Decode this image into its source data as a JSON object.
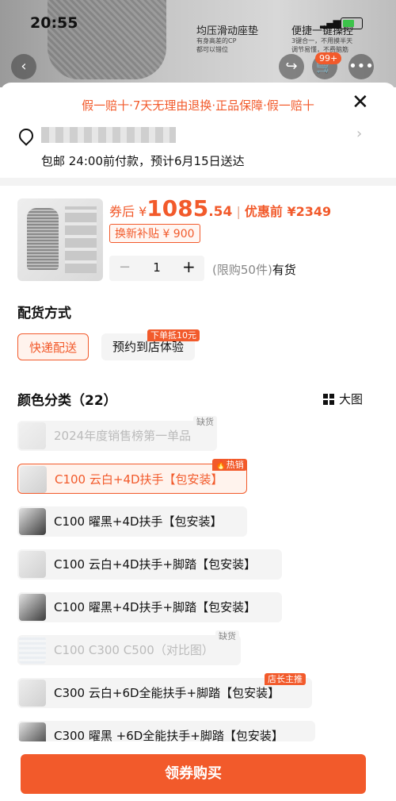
{
  "status_bar": {
    "time": "20:55"
  },
  "background": {
    "left_title": "均压滑动座垫",
    "left_sub_1": "有身高差的CP",
    "left_sub_2": "都可以错位",
    "right_title": "便捷一键操控",
    "right_sub_1": "3键合一，不用摸半天",
    "right_sub_2": "调节易懂，不费脑筋",
    "cart_badge": "99+"
  },
  "banner": "假一赔十·7天无理由退换·正品保障·假一赔十",
  "delivery": {
    "text": "包邮 24:00前付款，预计6月15日送达"
  },
  "product": {
    "price_prefix": "券后 ¥",
    "price_int": "1085",
    "price_dec": ".54",
    "separator": "|",
    "original_price": "优惠前 ¥2349",
    "subsidy": "换新补贴 ¥ 900",
    "quantity": "1",
    "minus": "−",
    "plus": "+",
    "limit": "(限购50件)",
    "stock": "有货"
  },
  "shipping": {
    "title": "配货方式",
    "options": [
      "快递配送",
      "预约到店体验"
    ],
    "option_tag": "下单抵10元"
  },
  "colors": {
    "title": "颜色分类（22）",
    "big_view": "大图",
    "items": [
      {
        "label": "2024年度销售榜第一单品",
        "tag": "缺货"
      },
      {
        "label": "C100 云白+4D扶手【包安装】",
        "tag": "热销"
      },
      {
        "label": "C100 曜黑+4D扶手【包安装】"
      },
      {
        "label": "C100 云白+4D扶手+脚踏【包安装】"
      },
      {
        "label": "C100 曜黑+4D扶手+脚踏【包安装】"
      },
      {
        "label": "C100 C300 C500（对比图）",
        "tag": "缺货"
      },
      {
        "label": "C300 云白+6D全能扶手+脚踏【包安装】",
        "tag": "店长主推"
      },
      {
        "label": "C300 曜黑 +6D全能扶手+脚踏【包安装】"
      }
    ]
  },
  "cta": "领券购买",
  "colors_palette": {
    "accent": "#f25a2b",
    "option_bg": "#f4f4f4"
  }
}
